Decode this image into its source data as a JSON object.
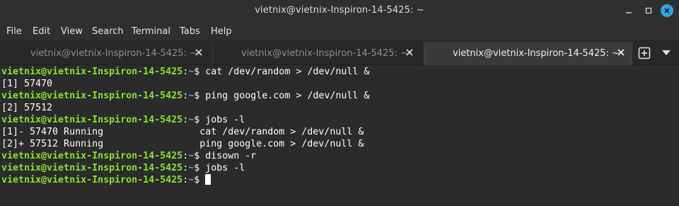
{
  "window": {
    "title": "vietnix@vietnix-Inspiron-14-5425: ~"
  },
  "menu": [
    "File",
    "Edit",
    "View",
    "Search",
    "Terminal",
    "Tabs",
    "Help"
  ],
  "tabs": [
    {
      "label": "vietnix@vietnix-Inspiron-14-5425: ~",
      "active": false
    },
    {
      "label": "vietnix@vietnix-Inspiron-14-5425: ~",
      "active": false
    },
    {
      "label": "vietnix@vietnix-Inspiron-14-5425: ~",
      "active": true
    }
  ],
  "prompt": {
    "user": "vietnix@vietnix-Inspiron-14-5425",
    "colon": ":",
    "path": "~",
    "symbol": "$"
  },
  "lines": [
    {
      "type": "prompt",
      "cmd": " cat /dev/random > /dev/null &"
    },
    {
      "type": "out",
      "text": "[1] 57470"
    },
    {
      "type": "prompt",
      "cmd": " ping google.com > /dev/null &"
    },
    {
      "type": "out",
      "text": "[2] 57512"
    },
    {
      "type": "prompt",
      "cmd": " jobs -l"
    },
    {
      "type": "out",
      "text": "[1]- 57470 Running                 cat /dev/random > /dev/null &"
    },
    {
      "type": "out",
      "text": "[2]+ 57512 Running                 ping google.com > /dev/null &"
    },
    {
      "type": "prompt",
      "cmd": " disown -r"
    },
    {
      "type": "prompt",
      "cmd": " jobs -l"
    },
    {
      "type": "prompt",
      "cmd": " "
    }
  ],
  "colors": {
    "user": "#8ae234",
    "path": "#729fcf",
    "accent": "#35a3e0",
    "background": "#2b2b2b"
  }
}
